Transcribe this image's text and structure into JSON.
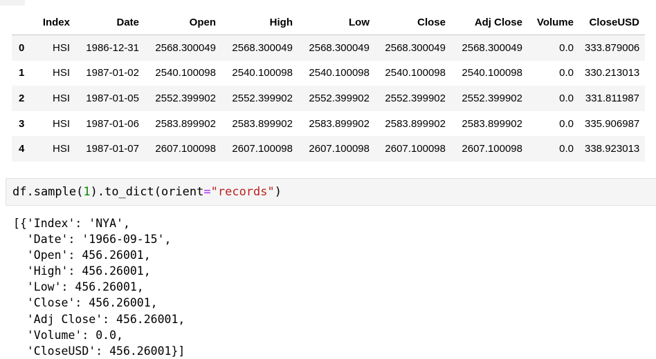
{
  "dataframe": {
    "columns": [
      "Index",
      "Date",
      "Open",
      "High",
      "Low",
      "Close",
      "Adj Close",
      "Volume",
      "CloseUSD"
    ],
    "rows": [
      {
        "idx": "0",
        "cells": [
          "HSI",
          "1986-12-31",
          "2568.300049",
          "2568.300049",
          "2568.300049",
          "2568.300049",
          "2568.300049",
          "0.0",
          "333.879006"
        ]
      },
      {
        "idx": "1",
        "cells": [
          "HSI",
          "1987-01-02",
          "2540.100098",
          "2540.100098",
          "2540.100098",
          "2540.100098",
          "2540.100098",
          "0.0",
          "330.213013"
        ]
      },
      {
        "idx": "2",
        "cells": [
          "HSI",
          "1987-01-05",
          "2552.399902",
          "2552.399902",
          "2552.399902",
          "2552.399902",
          "2552.399902",
          "0.0",
          "331.811987"
        ]
      },
      {
        "idx": "3",
        "cells": [
          "HSI",
          "1987-01-06",
          "2583.899902",
          "2583.899902",
          "2583.899902",
          "2583.899902",
          "2583.899902",
          "0.0",
          "335.906987"
        ]
      },
      {
        "idx": "4",
        "cells": [
          "HSI",
          "1987-01-07",
          "2607.100098",
          "2607.100098",
          "2607.100098",
          "2607.100098",
          "2607.100098",
          "0.0",
          "338.923013"
        ]
      }
    ]
  },
  "code_cell": {
    "tokens": {
      "t1": "df.sample(",
      "t2": "1",
      "t3": ").to_dict(orient",
      "t4": "=",
      "t5": "\"records\"",
      "t6": ")"
    }
  },
  "output": {
    "lines": [
      "[{'Index': 'NYA',",
      "  'Date': '1966-09-15',",
      "  'Open': 456.26001,",
      "  'High': 456.26001,",
      "  'Low': 456.26001,",
      "  'Close': 456.26001,",
      "  'Adj Close': 456.26001,",
      "  'Volume': 0.0,",
      "  'CloseUSD': 456.26001}]"
    ]
  },
  "colors": {
    "number_token": "#008800",
    "operator_token": "#aa22ff",
    "string_token": "#ba2121",
    "striped_row": "#f5f5f5"
  }
}
